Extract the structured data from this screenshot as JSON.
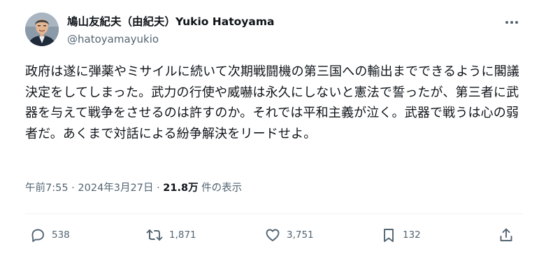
{
  "author": {
    "display_name": "鳩山友紀夫（由紀夫）Yukio Hatoyama",
    "handle": "@hatoyamayukio"
  },
  "tweet": {
    "text": "政府は遂に弾薬やミサイルに続いて次期戦闘機の第三国への輸出までできるように閣議決定をしてしまった。武力の行使や威嚇は永久にしないと憲法で誓ったが、第三者に武器を与えて戦争をさせるのは許すのか。それでは平和主義が泣く。武器で戦うは心の弱者だ。あくまで対話による紛争解決をリードせよ。"
  },
  "meta": {
    "time": "午前7:55",
    "separator": " · ",
    "date": "2024年3月27日",
    "separator2": " · ",
    "views": "21.8万",
    "views_label": " 件の表示"
  },
  "actions": {
    "reply_count": "538",
    "retweet_count": "1,871",
    "like_count": "3,751",
    "bookmark_count": "132"
  },
  "icons": {
    "more": "more-horizontal-icon",
    "reply": "reply-icon",
    "retweet": "retweet-icon",
    "like": "heart-icon",
    "bookmark": "bookmark-icon",
    "share": "share-icon"
  },
  "colors": {
    "text_primary": "#0f1419",
    "text_secondary": "#536471",
    "divider": "#eff3f4"
  }
}
